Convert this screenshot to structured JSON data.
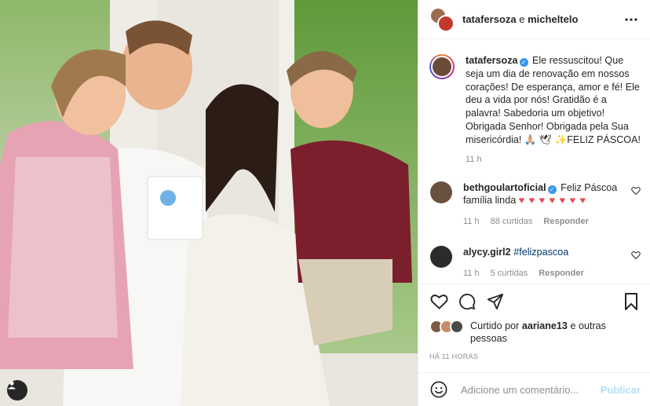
{
  "header": {
    "user1": "tatafersoza",
    "separator": "e",
    "user2": "micheltelo",
    "more_icon": "more-horizontal-icon"
  },
  "caption": {
    "username": "tatafersoza",
    "text": "Ele ressuscitou! Que seja um dia de renovação em nossos corações! De esperança, amor e fé! Ele deu a vida por nós! Gratidão é a palavra! Sabedoria um objetivo! Obrigada Senhor! Obrigada pela Sua misericórdia! 🙏🏼 🕊 ✨FELIZ PÁSCOA!",
    "time": "11 h"
  },
  "comments": [
    {
      "username": "bethgoulartoficial",
      "verified": true,
      "text": "Feliz Páscoa família linda",
      "hearts": "♥ ♥ ♥ ♥ ♥ ♥ ♥",
      "time": "11 h",
      "likes": "88 curtidas",
      "reply": "Responder",
      "avatar_color": "#6a5040"
    },
    {
      "username": "alycy.girl2",
      "verified": false,
      "text": "#felizpascoa",
      "time": "11 h",
      "likes": "5 curtidas",
      "reply": "Responder",
      "avatar_color": "#2b2b2b"
    }
  ],
  "likes_line": {
    "prefix": "Curtido por",
    "user": "aariane13",
    "suffix": "e outras pessoas"
  },
  "posted": "HÁ 11 HORAS",
  "add_comment": {
    "placeholder": "Adicione um comentário...",
    "publish": "Publicar"
  },
  "colors": {
    "text": "#262626",
    "muted": "#8e8e8e",
    "link": "#00376b",
    "verified": "#3897f0",
    "heart": "#ed4956",
    "publish_disabled": "#b2dffc"
  }
}
